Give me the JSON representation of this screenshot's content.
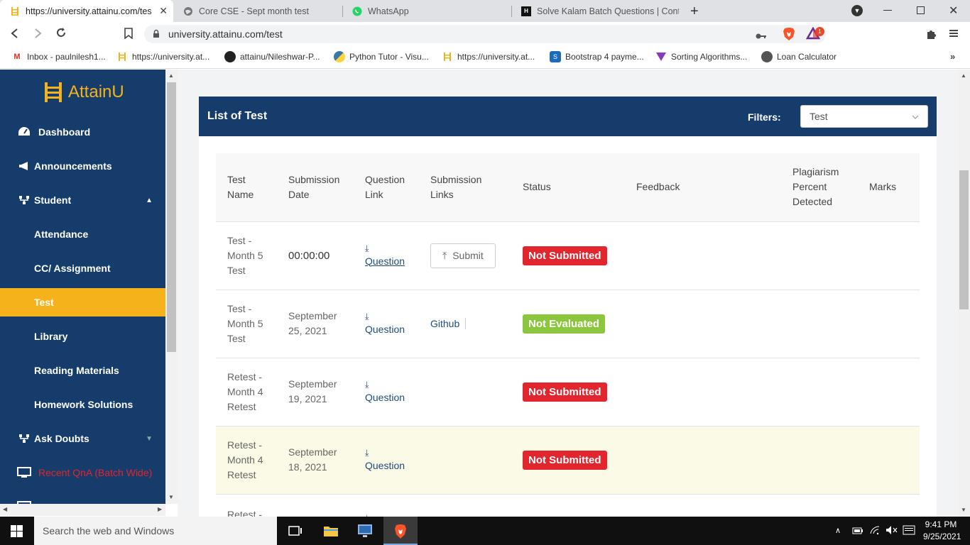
{
  "browser": {
    "tabs": [
      {
        "title": "https://university.attainu.com/tes",
        "active": true
      },
      {
        "title": "Core CSE - Sept month test",
        "active": false
      },
      {
        "title": "WhatsApp",
        "active": false
      },
      {
        "title": "Solve Kalam Batch Questions | Contest",
        "active": false
      }
    ],
    "url": "university.attainu.com/test",
    "brave_badge": "1",
    "bookmarks": [
      "Inbox - paulnilesh1...",
      "https://university.at...",
      "attainu/Nileshwar-P...",
      "Python Tutor - Visu...",
      "https://university.at...",
      "Bootstrap 4 payme...",
      "Sorting Algorithms...",
      "Loan Calculator"
    ]
  },
  "sidebar": {
    "brand": "AttainU",
    "items": [
      {
        "label": "Dashboard"
      },
      {
        "label": "Announcements"
      },
      {
        "label": "Student"
      },
      {
        "label": "Attendance"
      },
      {
        "label": "CC/ Assignment"
      },
      {
        "label": "Test"
      },
      {
        "label": "Library"
      },
      {
        "label": "Reading Materials"
      },
      {
        "label": "Homework Solutions"
      },
      {
        "label": "Ask Doubts"
      },
      {
        "label": "Recent QnA (Batch Wide)"
      }
    ]
  },
  "card": {
    "title": "List of Test",
    "filters_label": "Filters:",
    "filter_value": "Test"
  },
  "table": {
    "headers": {
      "test_name": [
        "Test",
        "Name"
      ],
      "submission_date": [
        "Submission",
        "Date"
      ],
      "question_link": [
        "Question",
        "Link"
      ],
      "submission_links": [
        "Submission",
        "Links"
      ],
      "status": "Status",
      "feedback": "Feedback",
      "plagiarism": [
        "Plagiarism",
        "Percent",
        "Detected"
      ],
      "marks": "Marks"
    },
    "rows": [
      {
        "name": [
          "Test -",
          "Month 5",
          "Test"
        ],
        "date": [
          "00:00:00",
          ""
        ],
        "question": "Question",
        "submission": "Submit",
        "status": "Not Submitted"
      },
      {
        "name": [
          "Test -",
          "Month 5",
          "Test"
        ],
        "date": [
          "September",
          "25, 2021"
        ],
        "question": "Question",
        "submission": "Github",
        "status": "Not Evaluated"
      },
      {
        "name": [
          "Retest -",
          "Month 4",
          "Retest"
        ],
        "date": [
          "September",
          "19, 2021"
        ],
        "question": "Question",
        "submission": "",
        "status": "Not Submitted"
      },
      {
        "name": [
          "Retest -",
          "Month 4",
          "Retest"
        ],
        "date": [
          "September",
          "18, 2021"
        ],
        "question": "Question",
        "submission": "",
        "status": "Not Submitted"
      },
      {
        "name": [
          "Retest -",
          "",
          ""
        ],
        "date": [
          "",
          ""
        ],
        "question": "",
        "submission": "",
        "status": ""
      }
    ]
  },
  "taskbar": {
    "search_placeholder": "Search the web and Windows",
    "time": "9:41 PM",
    "date": "9/25/2021"
  }
}
